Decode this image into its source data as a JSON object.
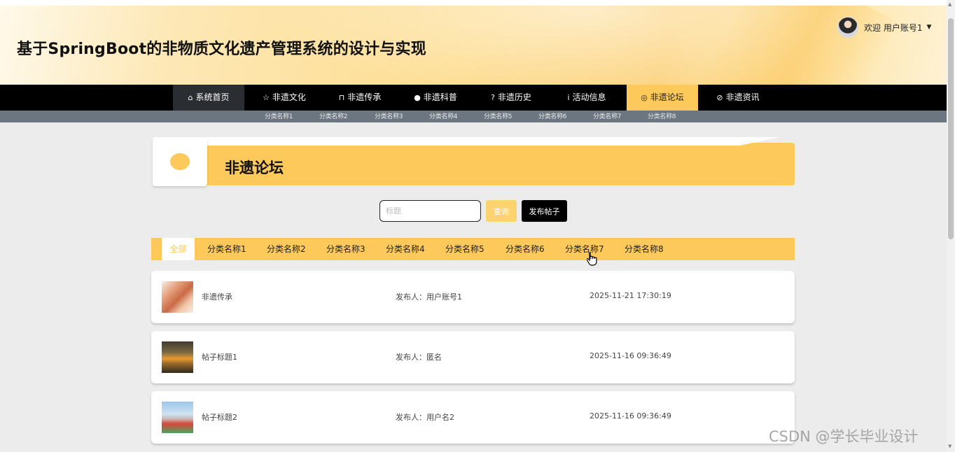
{
  "header": {
    "site_title": "基于SpringBoot的非物质文化遗产管理系统的设计与实现",
    "welcome": "欢迎 用户账号1",
    "caret": "▼"
  },
  "nav": {
    "items": [
      {
        "icon": "⌂",
        "label": "系统首页"
      },
      {
        "icon": "☆",
        "label": "非遗文化"
      },
      {
        "icon": "⊓",
        "label": "非遗传承"
      },
      {
        "icon": "●",
        "label": "非遗科普"
      },
      {
        "icon": "?",
        "label": "非遗历史"
      },
      {
        "icon": "i",
        "label": "活动信息"
      },
      {
        "icon": "◎",
        "label": "非遗论坛"
      },
      {
        "icon": "⊘",
        "label": "非遗资讯"
      }
    ],
    "active_index": 6
  },
  "subnav": {
    "items": [
      "分类名称1",
      "分类名称2",
      "分类名称3",
      "分类名称4",
      "分类名称5",
      "分类名称6",
      "分类名称7",
      "分类名称8"
    ]
  },
  "banner": {
    "title": "非遗论坛"
  },
  "search": {
    "placeholder": "标题",
    "query_label": "查询",
    "post_label": "发布帖子"
  },
  "categories": {
    "items": [
      "全部",
      "分类名称1",
      "分类名称2",
      "分类名称3",
      "分类名称4",
      "分类名称5",
      "分类名称6",
      "分类名称7",
      "分类名称8"
    ],
    "active_index": 0
  },
  "posts": [
    {
      "title": "非遗传承",
      "author": "发布人：用户账号1",
      "time": "2025-11-21 17:30:19"
    },
    {
      "title": "帖子标题1",
      "author": "发布人：匿名",
      "time": "2025-11-16 09:36:49"
    },
    {
      "title": "帖子标题2",
      "author": "发布人：用户名2",
      "time": "2025-11-16 09:36:49"
    }
  ],
  "watermark": "CSDN @学长毕业设计",
  "colors": {
    "accent": "#fcc95a",
    "nav_bg": "#000000",
    "subnav_bg": "#6b7680",
    "page_bg": "#ececec"
  }
}
